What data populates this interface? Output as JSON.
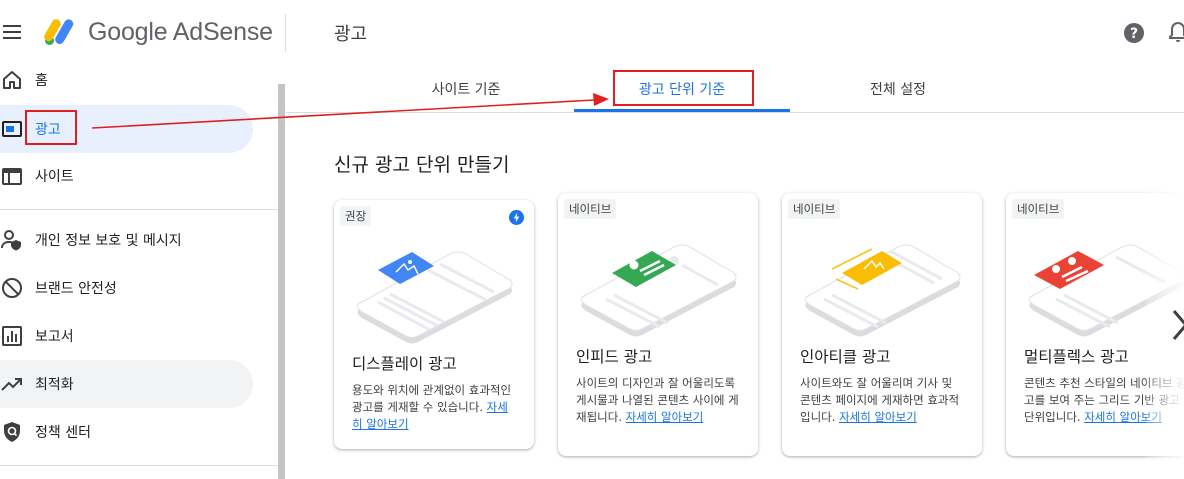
{
  "header": {
    "logo_text": "Google AdSense",
    "page_title": "광고"
  },
  "sidebar": {
    "items": [
      {
        "label": "홈",
        "icon": "home-icon"
      },
      {
        "label": "광고",
        "icon": "ads-icon",
        "active": true
      },
      {
        "label": "사이트",
        "icon": "sites-icon"
      },
      {
        "label": "개인 정보 보호 및 메시지",
        "icon": "privacy-icon"
      },
      {
        "label": "브랜드 안전성",
        "icon": "block-icon"
      },
      {
        "label": "보고서",
        "icon": "reports-icon"
      },
      {
        "label": "최적화",
        "icon": "trending-icon"
      },
      {
        "label": "정책 센터",
        "icon": "shield-icon"
      }
    ]
  },
  "tabs": [
    {
      "label": "사이트 기준"
    },
    {
      "label": "광고 단위 기준",
      "active": true
    },
    {
      "label": "전체 설정"
    }
  ],
  "section_title": "신규 광고 단위 만들기",
  "cards": [
    {
      "chip": "권장",
      "title": "디스플레이 광고",
      "desc": "용도와 위치에 관계없이 효과적인 광고를 게재할 수 있습니다.",
      "link": "자세히 알아보기",
      "accent": "#4285f4"
    },
    {
      "chip": "네이티브",
      "title": "인피드 광고",
      "desc": "사이트의 디자인과 잘 어울리도록 게시물과 나열된 콘텐츠 사이에 게재됩니다.",
      "link": "자세히 알아보기",
      "accent": "#34a853"
    },
    {
      "chip": "네이티브",
      "title": "인아티클 광고",
      "desc": "사이트와도 잘 어울리며 기사 및 콘텐츠 페이지에 게재하면 효과적입니다.",
      "link": "자세히 알아보기",
      "accent": "#fbbc04"
    },
    {
      "chip": "네이티브",
      "title": "멀티플렉스 광고",
      "desc": "콘텐츠 추천 스타일의 네이티브 광고를 보여 주는 그리드 기반 광고 단위입니다.",
      "link": "자세히 알아보기",
      "accent": "#ea4335"
    }
  ],
  "colors": {
    "primary": "#1a73e8",
    "active_bg": "#e8f0fe",
    "annotation": "#e02020"
  }
}
